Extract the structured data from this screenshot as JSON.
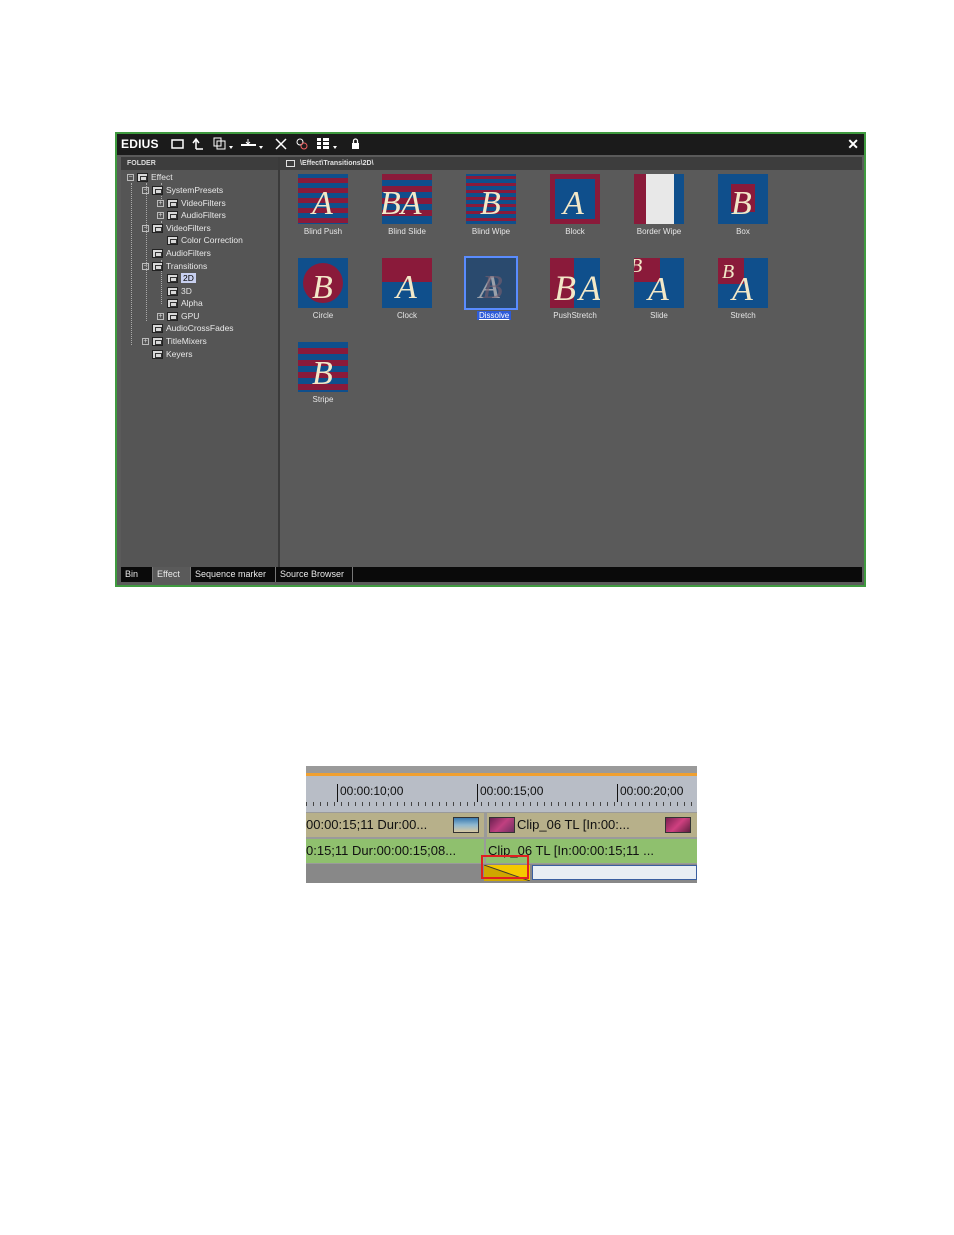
{
  "app": {
    "title": "EDIUS",
    "close_symbol": "✕",
    "toolbar_icons": [
      "new-folder-icon",
      "up-folder-icon",
      "copy-icon",
      "drop-icon",
      "delete-icon",
      "properties-icon",
      "view-icon",
      "lock-icon"
    ]
  },
  "folder_pane": {
    "header": "FOLDER",
    "tree": [
      {
        "label": "Effect",
        "expander": "−"
      },
      {
        "label": "SystemPresets",
        "expander": "−"
      },
      {
        "label": "VideoFilters",
        "expander": "+"
      },
      {
        "label": "AudioFilters",
        "expander": "+"
      },
      {
        "label": "VideoFilters",
        "expander": "−"
      },
      {
        "label": "Color Correction",
        "expander": ""
      },
      {
        "label": "AudioFilters",
        "expander": ""
      },
      {
        "label": "Transitions",
        "expander": "−"
      },
      {
        "label": "2D",
        "expander": ""
      },
      {
        "label": "3D",
        "expander": ""
      },
      {
        "label": "Alpha",
        "expander": ""
      },
      {
        "label": "GPU",
        "expander": "+"
      },
      {
        "label": "AudioCrossFades",
        "expander": ""
      },
      {
        "label": "TitleMixers",
        "expander": "+"
      },
      {
        "label": "Keyers",
        "expander": ""
      }
    ]
  },
  "content_pane": {
    "path": "\\Effect\\Transitions\\2D\\",
    "effects": [
      {
        "label": "Blind Push"
      },
      {
        "label": "Blind Slide"
      },
      {
        "label": "Blind Wipe"
      },
      {
        "label": "Block"
      },
      {
        "label": "Border Wipe"
      },
      {
        "label": "Box"
      },
      {
        "label": "Circle"
      },
      {
        "label": "Clock"
      },
      {
        "label": "Dissolve"
      },
      {
        "label": "PushStretch"
      },
      {
        "label": "Slide"
      },
      {
        "label": "Stretch"
      },
      {
        "label": "Stripe"
      }
    ],
    "selected": "Dissolve"
  },
  "tabs": [
    {
      "label": "Bin"
    },
    {
      "label": "Effect"
    },
    {
      "label": "Sequence marker"
    },
    {
      "label": "Source Browser"
    }
  ],
  "timeline": {
    "timecodes": [
      "00:00:10;00",
      "00:00:15;00",
      "00:00:20;00"
    ],
    "track1": {
      "left_text": "00:00:15;11 Dur:00...",
      "right_text": "Clip_06  TL [In:00:..."
    },
    "track2": {
      "left_text": "0:15;11 Dur:00:00:15;08...",
      "right_text": "Clip_06  TL [In:00:00:15;11 ..."
    }
  },
  "colors": {
    "panel_border": "#3f9a3f",
    "thumb_blue": "#0f4f8c",
    "thumb_red": "#8a1a3a",
    "transition_yellow": "#f5c800",
    "highlight_red": "#e02020"
  }
}
